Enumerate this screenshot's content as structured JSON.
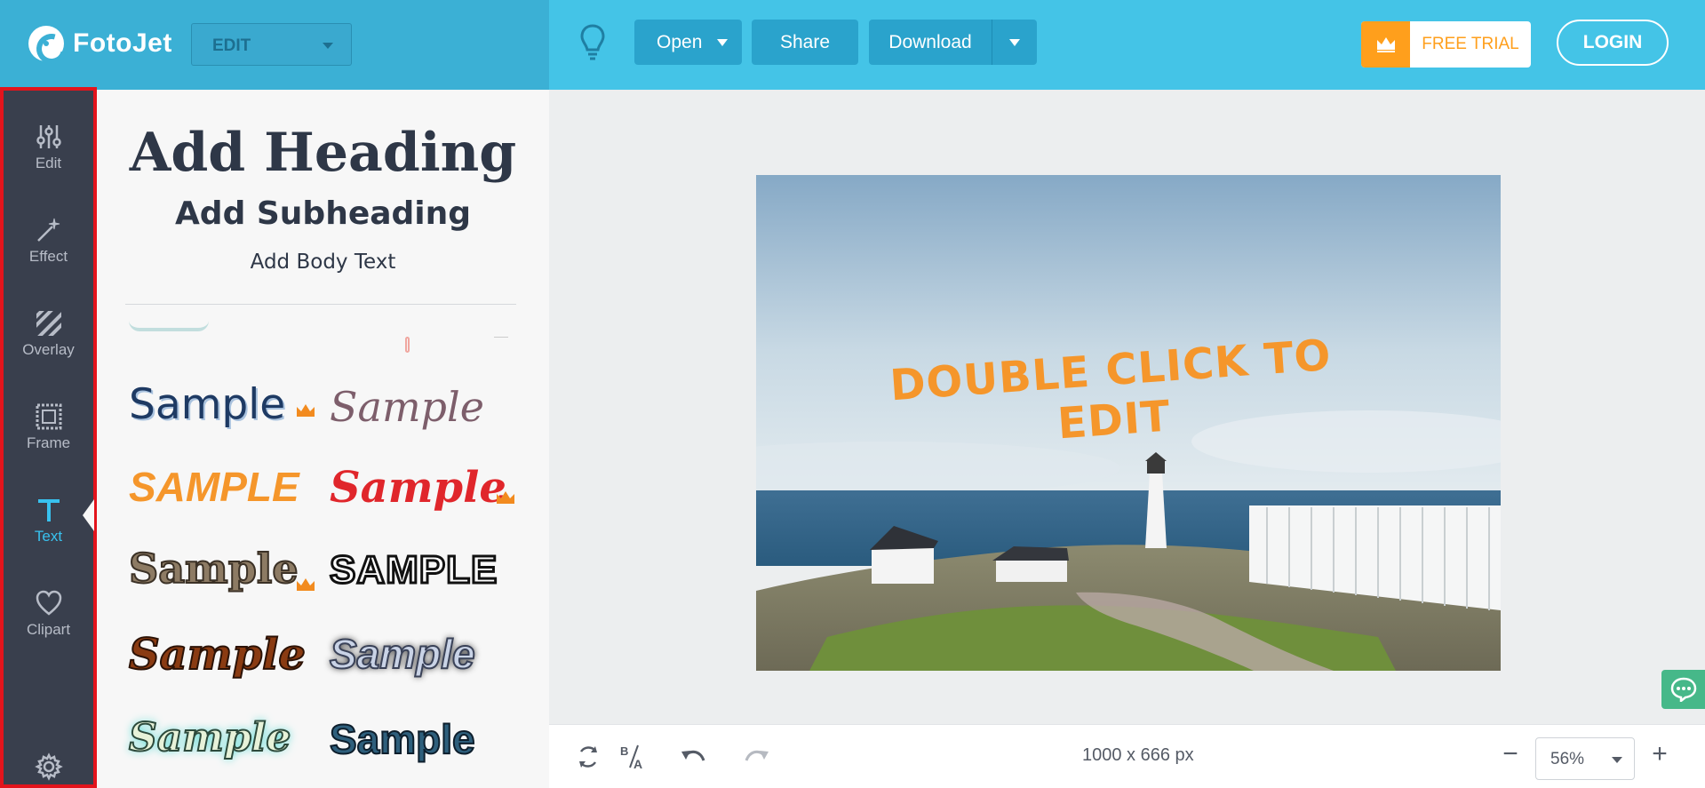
{
  "app": {
    "logo_text": "FotoJet",
    "mode_select_value": "EDIT"
  },
  "toolbar": {
    "open_label": "Open",
    "share_label": "Share",
    "download_label": "Download",
    "free_trial_label": "FREE TRIAL",
    "login_label": "LOGIN"
  },
  "rail": {
    "items": [
      {
        "label": "Edit",
        "icon": "sliders-icon"
      },
      {
        "label": "Effect",
        "icon": "magic-wand-icon"
      },
      {
        "label": "Overlay",
        "icon": "stripes-icon"
      },
      {
        "label": "Frame",
        "icon": "frame-icon"
      },
      {
        "label": "Text",
        "icon": "text-t-icon",
        "active": true
      },
      {
        "label": "Clipart",
        "icon": "heart-icon"
      }
    ],
    "settings_icon": "gear-icon"
  },
  "text_panel": {
    "heading": "Add Heading",
    "subheading": "Add Subheading",
    "body": "Add Body Text",
    "samples": [
      "Sample",
      "Sample",
      "SAMPLE",
      "Sample",
      "Sample",
      "SAMPLE",
      "Sample",
      "Sample",
      "Sample",
      "Sample"
    ]
  },
  "canvas": {
    "overlay_text": "DOUBLE CLICK TO EDIT",
    "dimensions": "1000 x 666 px",
    "zoom": "56%"
  },
  "colors": {
    "topbar": "#44c4e7",
    "topbar_left": "#3bb0d5",
    "rail": "#393f4d",
    "rail_highlight": "#e3141c",
    "accent_orange": "#ff9f1c",
    "overlay_text": "#f5962b"
  }
}
